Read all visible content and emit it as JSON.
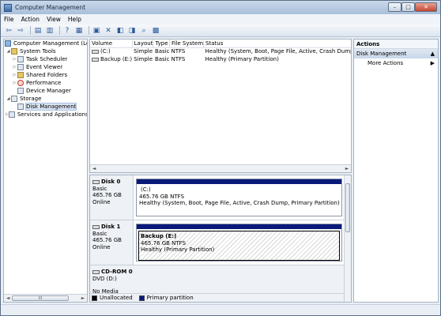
{
  "window": {
    "title": "Computer Management"
  },
  "menu": [
    "File",
    "Action",
    "View",
    "Help"
  ],
  "toolbar_icons": [
    "back-arrow-icon",
    "forward-arrow-icon",
    "up-folder-icon",
    "show-hide-tree-icon",
    "help-icon",
    "console-icon",
    "properties-icon",
    "delete-icon",
    "export-icon",
    "open-icon",
    "search-icon",
    "disk-icon"
  ],
  "tree": {
    "root": "Computer Management (Local",
    "system_tools": "System Tools",
    "task_scheduler": "Task Scheduler",
    "event_viewer": "Event Viewer",
    "shared_folders": "Shared Folders",
    "performance": "Performance",
    "device_manager": "Device Manager",
    "storage": "Storage",
    "disk_management": "Disk Management",
    "services": "Services and Applications"
  },
  "volumes": {
    "columns": [
      "Volume",
      "Layout",
      "Type",
      "File System",
      "Status"
    ],
    "rows": [
      [
        "(C:)",
        "Simple",
        "Basic",
        "NTFS",
        "Healthy (System, Boot, Page File, Active, Crash Dump, Primary Par"
      ],
      [
        "Backup (E:)",
        "Simple",
        "Basic",
        "NTFS",
        "Healthy (Primary Partition)"
      ]
    ]
  },
  "disks": [
    {
      "name": "Disk 0",
      "type": "Basic",
      "size": "465.76 GB",
      "state": "Online",
      "part_name": "(C:)",
      "part_size": "465.76 GB NTFS",
      "part_status": "Healthy (System, Boot, Page File, Active, Crash Dump, Primary Partition)"
    },
    {
      "name": "Disk 1",
      "type": "Basic",
      "size": "465.76 GB",
      "state": "Online",
      "part_name": "Backup  (E:)",
      "part_size": "465.76 GB NTFS",
      "part_status": "Healthy (Primary Partition)"
    },
    {
      "name": "CD-ROM 0",
      "type": "DVD (D:)",
      "state": "No Media"
    }
  ],
  "legend": {
    "unallocated": "Unallocated",
    "primary": "Primary partition",
    "unallocated_color": "#000000",
    "primary_color": "#0a1a7a"
  },
  "actions": {
    "header": "Actions",
    "section": "Disk Management",
    "more": "More Actions"
  },
  "scroll_glyphs": {
    "left": "◄",
    "right": "►",
    "grip": "III"
  }
}
